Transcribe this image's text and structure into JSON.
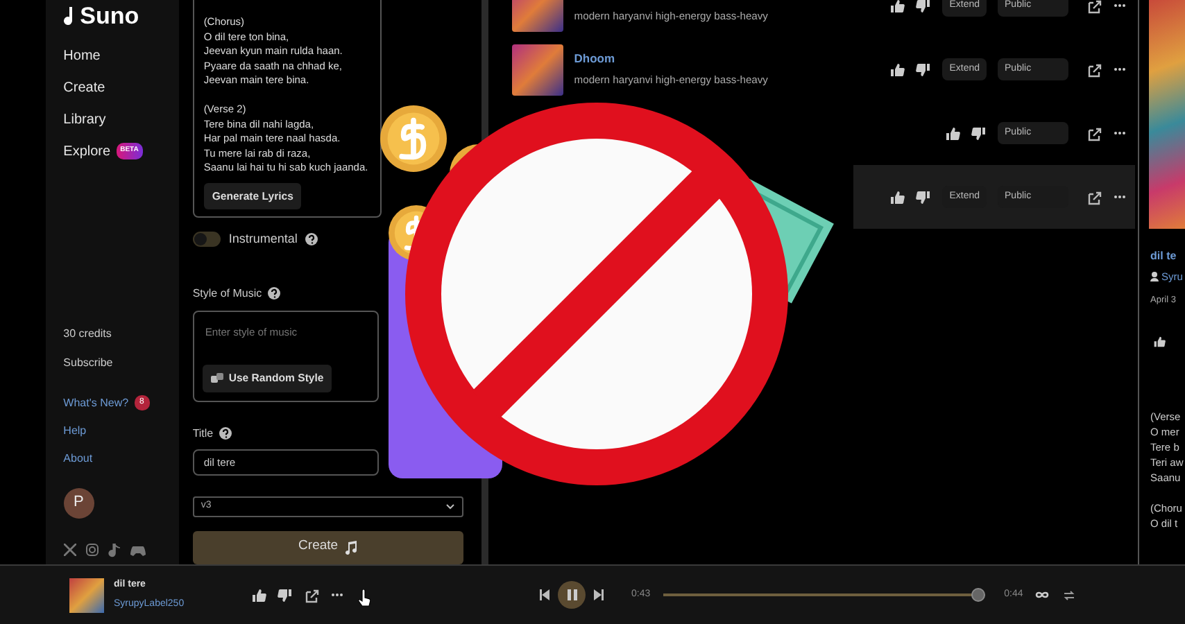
{
  "sidebar": {
    "logo": "Suno",
    "nav": [
      {
        "label": "Home"
      },
      {
        "label": "Create"
      },
      {
        "label": "Library"
      },
      {
        "label": "Explore",
        "badge": "BETA"
      }
    ],
    "credits": "30 credits",
    "subscribe": "Subscribe",
    "links": [
      {
        "label": "What's New?",
        "badge": "8"
      },
      {
        "label": "Help"
      },
      {
        "label": "About"
      }
    ],
    "avatar": "P"
  },
  "create": {
    "lyrics": [
      [
        "(Chorus)",
        "O dil tere ton bina,",
        "Jeevan kyun main rulda haan.",
        "Pyaare da saath na chhad ke,",
        "Jeevan main tere bina."
      ],
      [
        "(Verse 2)",
        "Tere bina dil nahi lagda,",
        "Har pal main tere naal hasda.",
        "Tu mere lai rab di raza,",
        "Saanu lai hai tu hi sab kuch jaanda."
      ]
    ],
    "generate_button": "Generate Lyrics",
    "instrumental": {
      "label": "Instrumental",
      "on": false
    },
    "style": {
      "label": "Style of Music",
      "placeholder": "Enter style of music",
      "random_button": "Use Random Style"
    },
    "title": {
      "label": "Title",
      "value": "dil tere"
    },
    "model": "v3",
    "create_button": "Create"
  },
  "songs": [
    {
      "tags": "modern haryanvi high-energy bass-heavy",
      "extend": "Extend",
      "visibility": "Public",
      "highlighted": false
    },
    {
      "title": "Dhoom",
      "tags": "modern haryanvi high-energy bass-heavy",
      "extend": "Extend",
      "visibility": "Public",
      "highlighted": false
    },
    {
      "visibility": "Public",
      "highlighted": false
    },
    {
      "extend": "Extend",
      "visibility": "Public",
      "highlighted": true
    }
  ],
  "details": {
    "title": "dil te",
    "author": "Syru",
    "date": "April 3",
    "lyrics": [
      [
        "(Verse",
        "O mer",
        "Tere b",
        "Teri aw",
        "Saanu"
      ],
      [
        "(Choru",
        "O dil t"
      ]
    ]
  },
  "player": {
    "title": "dil tere",
    "artist": "SyrupyLabel250",
    "playing": true,
    "elapsed": "0:43",
    "level": 0.98,
    "duration": "0:44"
  }
}
